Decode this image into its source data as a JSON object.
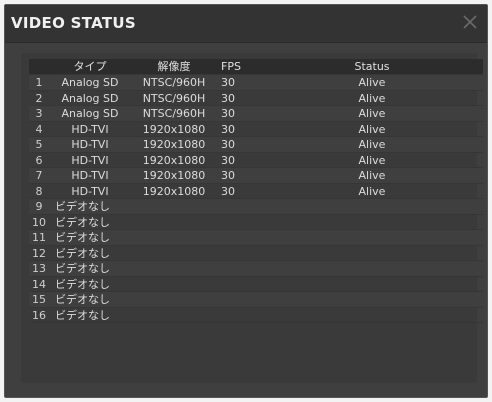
{
  "window": {
    "title": "VIDEO STATUS",
    "close_icon": "close-icon"
  },
  "table": {
    "headers": {
      "type": "タイプ",
      "resolution": "解像度",
      "fps": "FPS",
      "status": "Status"
    },
    "rows": [
      {
        "index": "1",
        "type": "Analog SD",
        "resolution": "NTSC/960H",
        "fps": "30",
        "status": "Alive"
      },
      {
        "index": "2",
        "type": "Analog SD",
        "resolution": "NTSC/960H",
        "fps": "30",
        "status": "Alive"
      },
      {
        "index": "3",
        "type": "Analog SD",
        "resolution": "NTSC/960H",
        "fps": "30",
        "status": "Alive"
      },
      {
        "index": "4",
        "type": "HD-TVI",
        "resolution": "1920x1080",
        "fps": "30",
        "status": "Alive"
      },
      {
        "index": "5",
        "type": "HD-TVI",
        "resolution": "1920x1080",
        "fps": "30",
        "status": "Alive"
      },
      {
        "index": "6",
        "type": "HD-TVI",
        "resolution": "1920x1080",
        "fps": "30",
        "status": "Alive"
      },
      {
        "index": "7",
        "type": "HD-TVI",
        "resolution": "1920x1080",
        "fps": "30",
        "status": "Alive"
      },
      {
        "index": "8",
        "type": "HD-TVI",
        "resolution": "1920x1080",
        "fps": "30",
        "status": "Alive"
      },
      {
        "index": "9",
        "type": "ビデオなし",
        "resolution": "",
        "fps": "",
        "status": ""
      },
      {
        "index": "10",
        "type": "ビデオなし",
        "resolution": "",
        "fps": "",
        "status": ""
      },
      {
        "index": "11",
        "type": "ビデオなし",
        "resolution": "",
        "fps": "",
        "status": ""
      },
      {
        "index": "12",
        "type": "ビデオなし",
        "resolution": "",
        "fps": "",
        "status": ""
      },
      {
        "index": "13",
        "type": "ビデオなし",
        "resolution": "",
        "fps": "",
        "status": ""
      },
      {
        "index": "14",
        "type": "ビデオなし",
        "resolution": "",
        "fps": "",
        "status": ""
      },
      {
        "index": "15",
        "type": "ビデオなし",
        "resolution": "",
        "fps": "",
        "status": ""
      },
      {
        "index": "16",
        "type": "ビデオなし",
        "resolution": "",
        "fps": "",
        "status": ""
      }
    ]
  },
  "colors": {
    "window_bg": "#3f3f3f",
    "title_bg": "#333333",
    "header_bg": "#2c2c2c",
    "text": "#dcdcdc"
  }
}
